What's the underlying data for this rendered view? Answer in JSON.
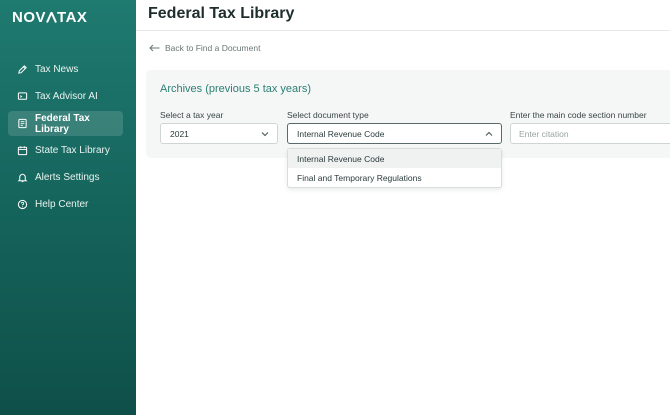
{
  "app": {
    "logo_text_1": "NOV",
    "logo_text_2": "TAX"
  },
  "sidebar": {
    "items": [
      {
        "label": "Tax News",
        "icon": "pen-icon",
        "active": false
      },
      {
        "label": "Tax Advisor AI",
        "icon": "chat-icon",
        "active": false
      },
      {
        "label": "Federal Tax Library",
        "icon": "book-icon",
        "active": true
      },
      {
        "label": "State Tax Library",
        "icon": "calendar-icon",
        "active": false
      },
      {
        "label": "Alerts Settings",
        "icon": "bell-icon",
        "active": false
      },
      {
        "label": "Help Center",
        "icon": "help-icon",
        "active": false
      }
    ]
  },
  "header": {
    "title": "Federal Tax Library"
  },
  "back_link": {
    "label": "Back to Find a Document",
    "icon": "arrow-left-icon"
  },
  "archives": {
    "title": "Archives (previous 5 tax years)",
    "tax_year": {
      "label": "Select a tax year",
      "value": "2021"
    },
    "document_type": {
      "label": "Select document type",
      "value": "Internal Revenue Code",
      "options": [
        "Internal Revenue Code",
        "Final and Temporary Regulations"
      ]
    },
    "code_section": {
      "label": "Enter the main code section number",
      "placeholder": "Enter citation"
    }
  },
  "colors": {
    "sidebar_top": "#1f7a70",
    "sidebar_bottom": "#0f4f49",
    "accent_text": "#2b7f74"
  }
}
